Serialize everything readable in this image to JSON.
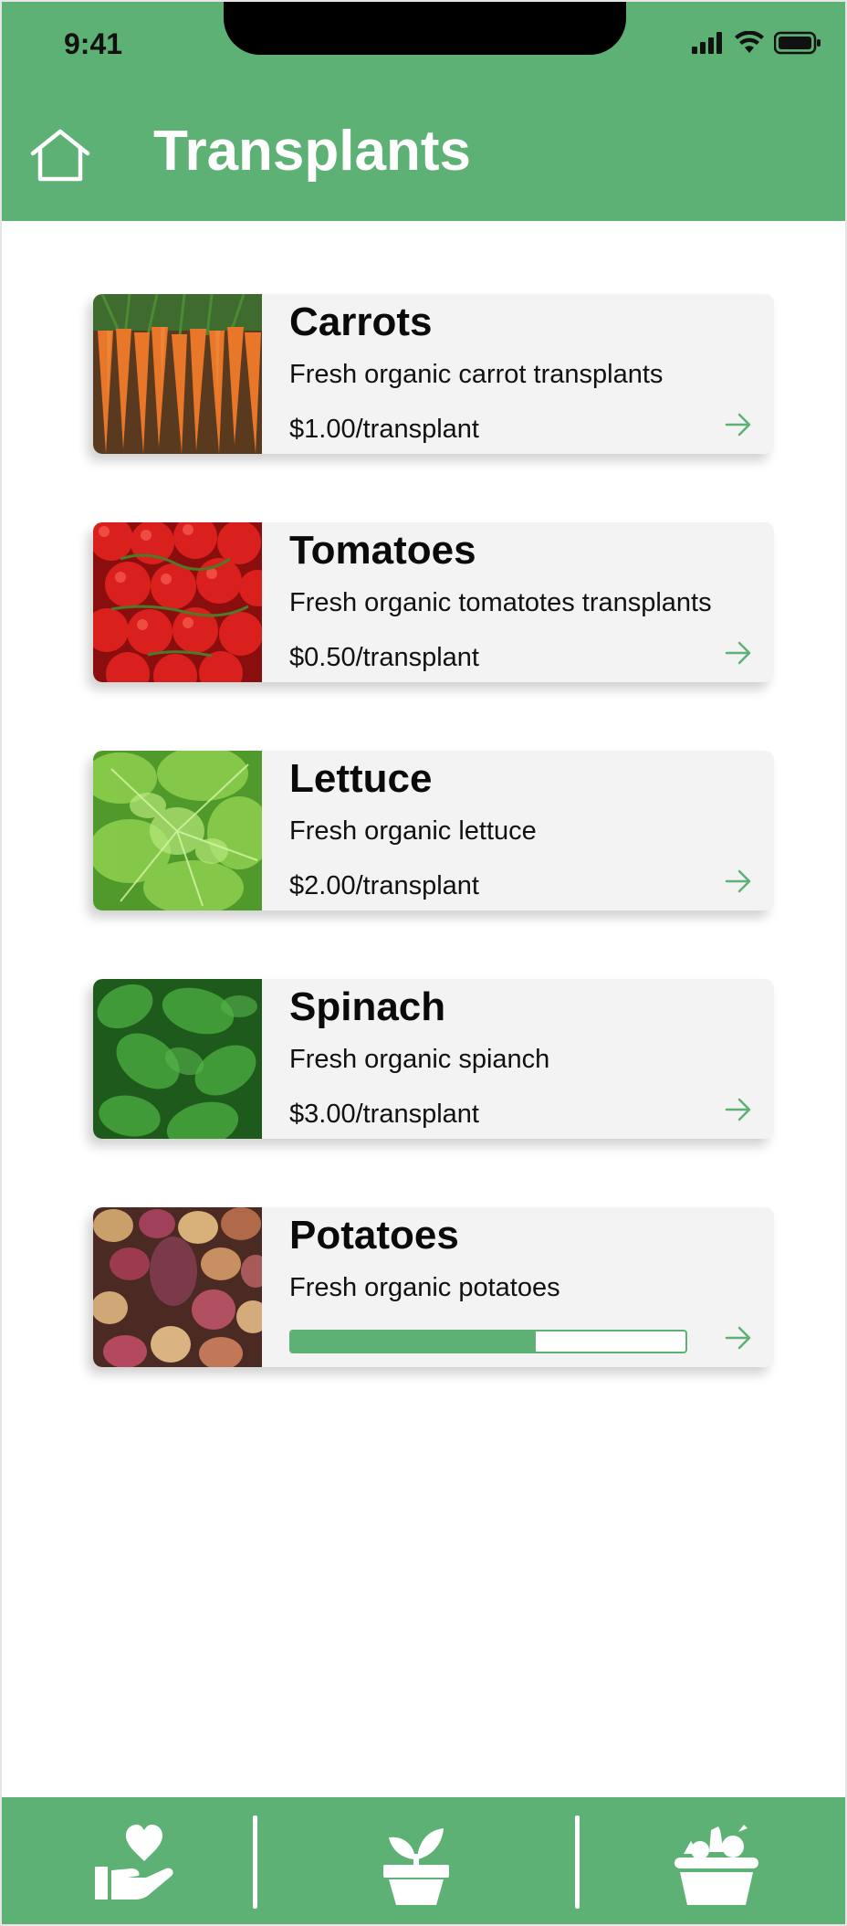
{
  "status_bar": {
    "time": "9:41"
  },
  "header": {
    "title": "Transplants",
    "home_icon": "house-outline-icon"
  },
  "theme": {
    "accent": "#5eb174",
    "card_bg": "#f3f3f3"
  },
  "products": [
    {
      "name": "Carrots",
      "description": "Fresh organic carrot transplants",
      "price": "$1.00/transplant",
      "image": "carrots"
    },
    {
      "name": "Tomatoes",
      "description": "Fresh organic tomatotes transplants",
      "price": "$0.50/transplant",
      "image": "tomatoes"
    },
    {
      "name": "Lettuce",
      "description": "Fresh organic lettuce",
      "price": "$2.00/transplant",
      "image": "lettuce"
    },
    {
      "name": "Spinach",
      "description": "Fresh organic spianch",
      "price": "$3.00/transplant",
      "image": "spinach"
    },
    {
      "name": "Potatoes",
      "description": "Fresh organic potatoes",
      "progress": 0.62,
      "image": "potatoes"
    }
  ],
  "bottom_nav": [
    {
      "icon": "hand-heart-icon"
    },
    {
      "icon": "potted-plant-icon"
    },
    {
      "icon": "vegetable-basket-icon"
    }
  ]
}
